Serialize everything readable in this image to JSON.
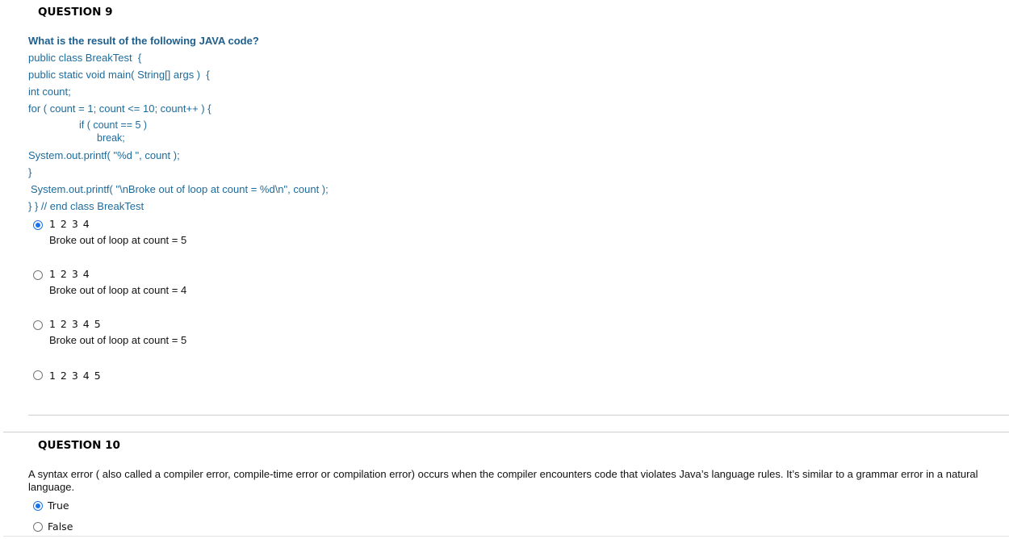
{
  "question9": {
    "header": "QUESTION 9",
    "prompt": "What is the result of the following JAVA code?",
    "code": [
      "public class BreakTest  {",
      "public static void main( String[] args )  {",
      "int count;",
      "for ( count = 1; count <= 10; count++ ) {",
      "if ( count == 5 )",
      "break;",
      "System.out.printf( \"%d \", count );",
      "}",
      "System.out.printf( \"\\nBroke out of loop at count = %d\\n\", count );",
      "} } // end class BreakTest"
    ],
    "options": [
      {
        "line1": "1 2 3 4",
        "line2": "Broke out of loop at count = 5",
        "selected": true
      },
      {
        "line1": "1 2 3 4",
        "line2": "Broke out of loop at count = 4",
        "selected": false
      },
      {
        "line1": "1 2 3 4 5",
        "line2": "Broke out of loop at count = 5",
        "selected": false
      },
      {
        "line1": "1 2 3 4 5",
        "line2": "",
        "selected": false
      }
    ]
  },
  "question10": {
    "header": "QUESTION 10",
    "prompt": "A syntax error ( also called a compiler error, compile-time error or compilation error) occurs when the compiler encounters code that violates Java’s language rules. It’s similar to a grammar error in a natural language.",
    "options": [
      {
        "label": "True",
        "selected": true
      },
      {
        "label": "False",
        "selected": false
      }
    ]
  },
  "colors": {
    "code_text": "#1d6b9c",
    "radio_accent": "#1a73e8",
    "divider": "#cfcfcf"
  }
}
